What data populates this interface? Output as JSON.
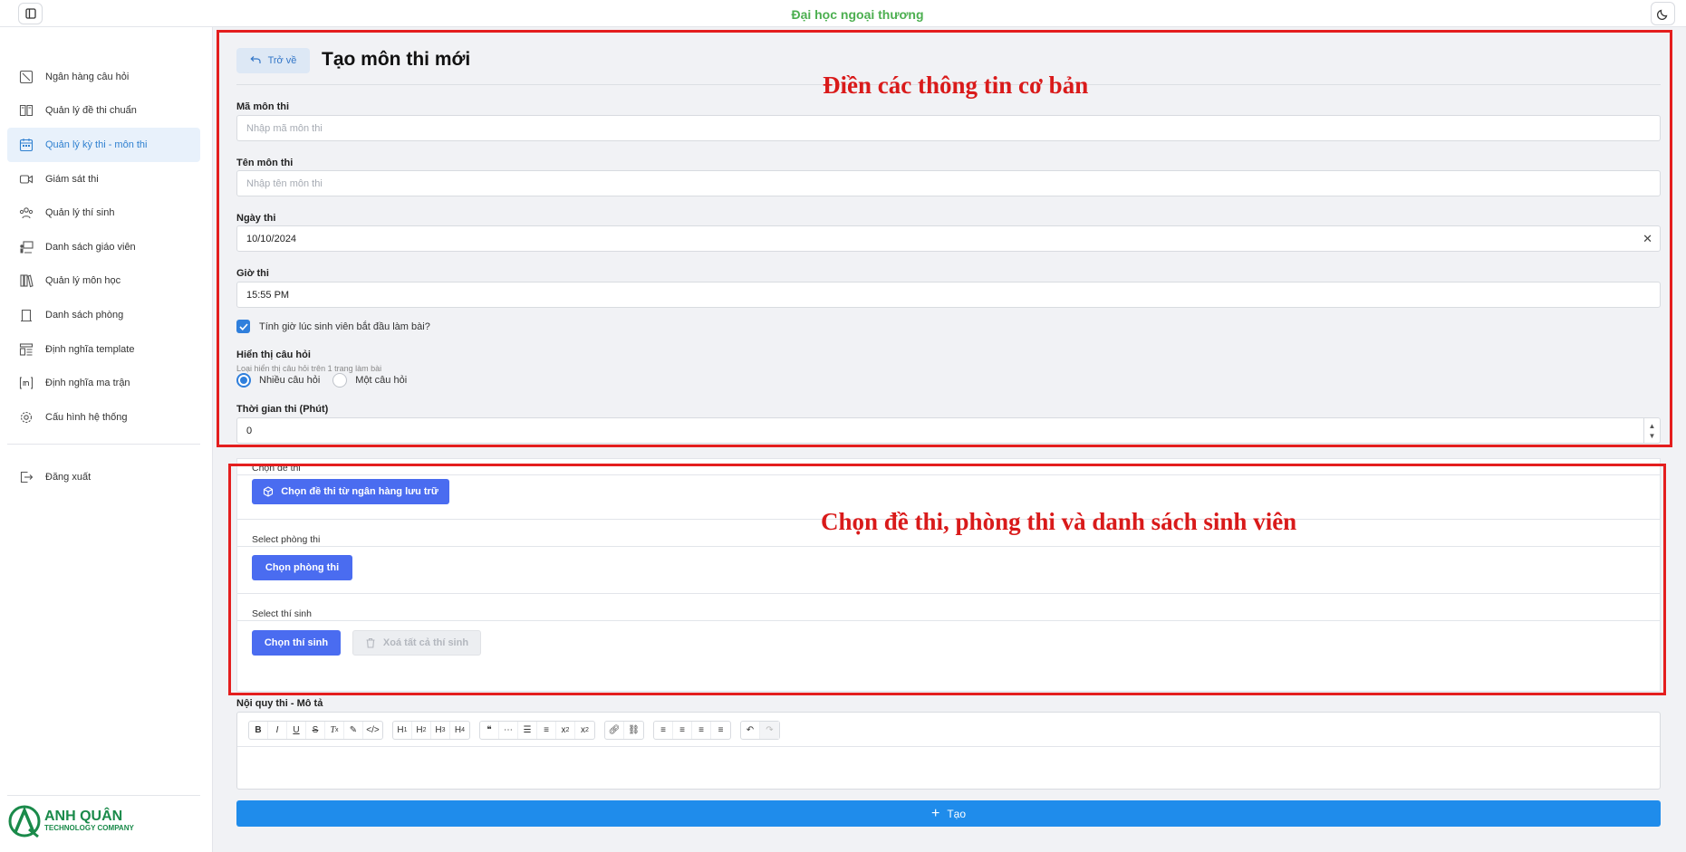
{
  "header": {
    "app_title": "Đại học ngoại thương"
  },
  "sidebar": {
    "items": [
      {
        "label": "Ngân hàng câu hỏi",
        "icon": "question-bank-icon"
      },
      {
        "label": "Quản lý đề thi chuẩn",
        "icon": "book-icon"
      },
      {
        "label": "Quản lý kỳ thi - môn thi",
        "icon": "calendar-icon",
        "active": true
      },
      {
        "label": "Giám sát thi",
        "icon": "video-icon"
      },
      {
        "label": "Quản lý thí sinh",
        "icon": "users-icon"
      },
      {
        "label": "Danh sách giáo viên",
        "icon": "teacher-icon"
      },
      {
        "label": "Quản lý môn học",
        "icon": "library-icon"
      },
      {
        "label": "Danh sách phòng",
        "icon": "door-icon"
      },
      {
        "label": "Định nghĩa template",
        "icon": "template-icon"
      },
      {
        "label": "Định nghĩa ma trận",
        "icon": "matrix-icon"
      },
      {
        "label": "Cấu hình hệ thống",
        "icon": "gear-icon"
      }
    ],
    "logout_label": "Đăng xuất",
    "logo_line1": "ANH QUÂN",
    "logo_line2": "TECHNOLOGY COMPANY"
  },
  "page": {
    "back_label": "Trở về",
    "title": "Tạo môn thi mới"
  },
  "form": {
    "subject_code_label": "Mã môn thi",
    "subject_code_placeholder": "Nhập mã môn thi",
    "subject_name_label": "Tên môn thi",
    "subject_name_placeholder": "Nhập tên môn thi",
    "exam_date_label": "Ngày thi",
    "exam_date_value": "10/10/2024",
    "exam_time_label": "Giờ thi",
    "exam_time_value": "15:55 PM",
    "start_timer_checkbox_label": "Tính giờ lúc sinh viên bắt đầu làm bài?",
    "start_timer_checked": true,
    "display_label": "Hiển thị câu hỏi",
    "display_hint": "Loại hiển thị câu hỏi trên 1 trang làm bài",
    "display_options": [
      "Nhiều câu hỏi",
      "Một câu hỏi"
    ],
    "display_selected": "Nhiều câu hỏi",
    "duration_label": "Thời gian thi (Phút)",
    "duration_value": "0"
  },
  "selection": {
    "exam_label": "Chọn đề thi",
    "exam_button": "Chọn đề thi từ ngân hàng lưu trữ",
    "room_label": "Select phòng thi",
    "room_button": "Chọn phòng thi",
    "students_label": "Select thí sinh",
    "students_button": "Chọn thí sinh",
    "clear_students_button": "Xoá tất cả thí sinh"
  },
  "rules": {
    "label": "Nội quy thi - Mô tả",
    "toolbar": [
      "B",
      "I",
      "U",
      "S",
      "Tx",
      "brush",
      "code",
      "H1",
      "H2",
      "H3",
      "H4",
      "quote",
      "hr",
      "ul",
      "ol",
      "sub",
      "sup",
      "link",
      "unlink",
      "align-left",
      "align-center",
      "justify",
      "align-right",
      "undo",
      "redo"
    ]
  },
  "create_button": "Tạo",
  "annotations": {
    "top": "Điền các thông tin cơ bản",
    "bottom": "Chọn đề thi, phòng thi và danh sách sinh viên"
  },
  "colors": {
    "accent": "#2f7fdc",
    "primary_button": "#4a6cf0",
    "create_button": "#1f8ceb",
    "brand_green": "#4caf50",
    "annotation_red": "#e41e1e"
  }
}
